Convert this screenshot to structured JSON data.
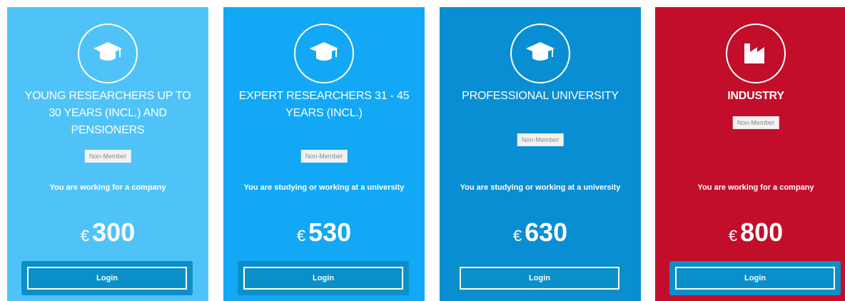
{
  "cards": [
    {
      "title": "YOUNG RESEARCHERS UP TO 30 YEARS (INCL.) AND PENSIONERS",
      "badge": "Non-Member",
      "description": "You are working for a company",
      "currency": "€",
      "price": "300",
      "login_label": "Login",
      "icon": "graduation-cap-icon",
      "color": "#4fc3f7"
    },
    {
      "title": "EXPERT RESEARCHERS 31 - 45 YEARS (INCL.)",
      "badge": "Non-Member",
      "description": "You are studying or working at a university",
      "currency": "€",
      "price": "530",
      "login_label": "Login",
      "icon": "graduation-cap-icon",
      "color": "#12a8f5"
    },
    {
      "title": "PROFESSIONAL UNIVERSITY",
      "badge": "Non-Member",
      "description": "You are studying or working at a university",
      "currency": "€",
      "price": "630",
      "login_label": "Login",
      "icon": "graduation-cap-icon",
      "color": "#0a8ed3"
    },
    {
      "title": "INDUSTRY",
      "badge": "Non-Member",
      "description": "You are working for a company",
      "currency": "€",
      "price": "800",
      "login_label": "Login",
      "icon": "factory-icon",
      "color": "#c20e2a"
    }
  ]
}
